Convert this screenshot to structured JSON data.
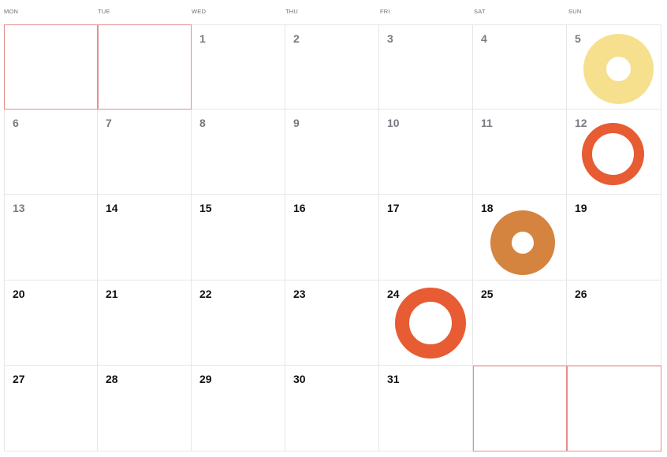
{
  "calendar": {
    "weekdays": [
      "MON",
      "TUE",
      "WED",
      "THU",
      "FRI",
      "SAT",
      "SUN"
    ],
    "rows": [
      [
        null,
        null,
        1,
        2,
        3,
        4,
        5
      ],
      [
        6,
        7,
        8,
        9,
        10,
        11,
        12
      ],
      [
        13,
        14,
        15,
        16,
        17,
        18,
        19
      ],
      [
        20,
        21,
        22,
        23,
        24,
        25,
        26
      ],
      [
        27,
        28,
        29,
        30,
        31,
        null,
        null
      ]
    ],
    "past_days": [
      1,
      2,
      3,
      4,
      5,
      6,
      7,
      8,
      9,
      10,
      11,
      12,
      13
    ],
    "colors": {
      "grid_line": "#e6e6e6",
      "empty_cell_border": "#e58d8d",
      "past_day_text": "#777b80",
      "current_day_text": "#111111",
      "weekday_text": "#6f6f6f"
    },
    "markers": [
      {
        "day": 5,
        "color": "#f6e08e",
        "style": "thick"
      },
      {
        "day": 12,
        "color": "#e75c33",
        "style": "thin"
      },
      {
        "day": 18,
        "color": "#d4843f",
        "style": "thick"
      },
      {
        "day": 24,
        "color": "#e75c33",
        "style": "medium"
      }
    ]
  }
}
